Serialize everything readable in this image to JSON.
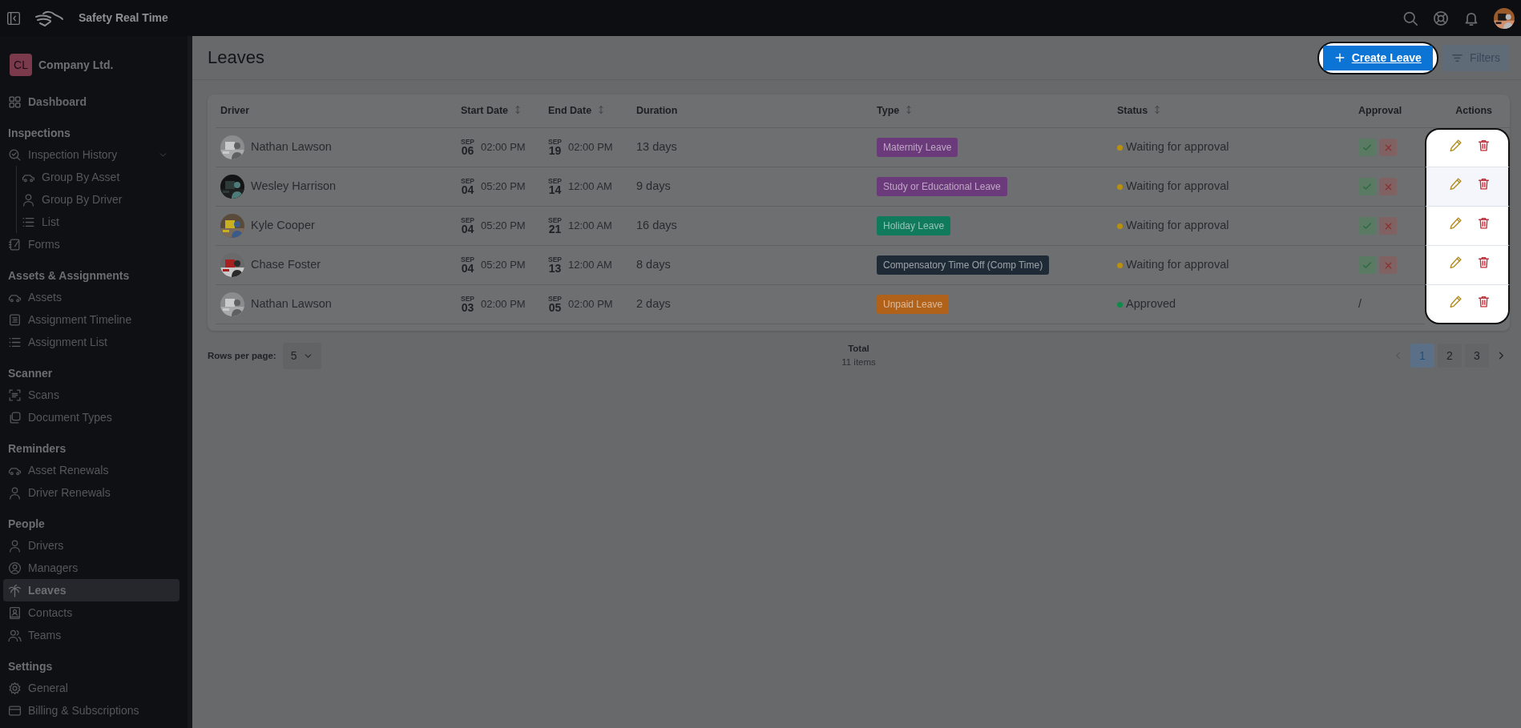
{
  "topbar": {
    "app_name": "Safety Real Time"
  },
  "sidebar": {
    "company": {
      "initials": "CL",
      "name": "Company Ltd."
    },
    "sections": [
      {
        "items": [
          {
            "label": "Dashboard",
            "selected": false
          }
        ]
      },
      {
        "title": "Inspections",
        "items": [
          {
            "label": "Inspection History",
            "selected": false,
            "expanded": true,
            "children": [
              {
                "label": "Group By Asset",
                "selected": false
              },
              {
                "label": "Group By Driver",
                "selected": false
              },
              {
                "label": "List",
                "selected": false
              }
            ]
          },
          {
            "label": "Forms",
            "selected": false
          }
        ]
      },
      {
        "title": "Assets & Assignments",
        "items": [
          {
            "label": "Assets",
            "selected": false
          },
          {
            "label": "Assignment Timeline",
            "selected": false
          },
          {
            "label": "Assignment List",
            "selected": false
          }
        ]
      },
      {
        "title": "Scanner",
        "items": [
          {
            "label": "Scans",
            "selected": false
          },
          {
            "label": "Document Types",
            "selected": false
          }
        ]
      },
      {
        "title": "Reminders",
        "items": [
          {
            "label": "Asset Renewals",
            "selected": false
          },
          {
            "label": "Driver Renewals",
            "selected": false
          }
        ]
      },
      {
        "title": "People",
        "items": [
          {
            "label": "Drivers",
            "selected": false
          },
          {
            "label": "Managers",
            "selected": false
          },
          {
            "label": "Leaves",
            "selected": true
          },
          {
            "label": "Contacts",
            "selected": false
          },
          {
            "label": "Teams",
            "selected": false
          }
        ]
      },
      {
        "title": "Settings",
        "items": [
          {
            "label": "General",
            "selected": false
          },
          {
            "label": "Billing & Subscriptions",
            "selected": false
          }
        ]
      }
    ]
  },
  "page": {
    "title": "Leaves",
    "create_button": {
      "label": "Create Leave",
      "spotlight": true
    },
    "filters_button": {
      "label": "Filters"
    }
  },
  "table": {
    "actions_spotlight": true,
    "columns": [
      {
        "label": "Driver",
        "sortable": false
      },
      {
        "label": "Start Date",
        "sortable": true
      },
      {
        "label": "End Date",
        "sortable": true
      },
      {
        "label": "Duration",
        "sortable": false
      },
      {
        "label": "Type",
        "sortable": true
      },
      {
        "label": "Status",
        "sortable": true
      },
      {
        "label": "Approval",
        "sortable": false
      },
      {
        "label": "Actions",
        "sortable": false
      }
    ],
    "rows": [
      {
        "driver": "Nathan Lawson",
        "start": {
          "month": "SEP",
          "day": "06",
          "time": "02:00 PM"
        },
        "end": {
          "month": "SEP",
          "day": "19",
          "time": "02:00 PM"
        },
        "duration": "13 days",
        "type": {
          "label": "Maternity Leave",
          "color": "#6b3a7a"
        },
        "status": {
          "label": "Waiting for approval",
          "color": "#b8900e"
        },
        "approval": {
          "kind": "buttons"
        }
      },
      {
        "driver": "Wesley Harrison",
        "start": {
          "month": "SEP",
          "day": "04",
          "time": "05:20 PM"
        },
        "end": {
          "month": "SEP",
          "day": "14",
          "time": "12:00 AM"
        },
        "duration": "9 days",
        "type": {
          "label": "Study or Educational Leave",
          "color": "#6b3a7a"
        },
        "status": {
          "label": "Waiting for approval",
          "color": "#b8900e"
        },
        "approval": {
          "kind": "buttons"
        }
      },
      {
        "driver": "Kyle Cooper",
        "start": {
          "month": "SEP",
          "day": "04",
          "time": "05:20 PM"
        },
        "end": {
          "month": "SEP",
          "day": "21",
          "time": "12:00 AM"
        },
        "duration": "16 days",
        "type": {
          "label": "Holiday Leave",
          "color": "#107a5c"
        },
        "status": {
          "label": "Waiting for approval",
          "color": "#b8900e"
        },
        "approval": {
          "kind": "buttons"
        }
      },
      {
        "driver": "Chase Foster",
        "start": {
          "month": "SEP",
          "day": "04",
          "time": "05:20 PM"
        },
        "end": {
          "month": "SEP",
          "day": "13",
          "time": "12:00 AM"
        },
        "duration": "8 days",
        "type": {
          "label": "Compensatory Time Off (Comp Time)",
          "color": "#1f2a37"
        },
        "status": {
          "label": "Waiting for approval",
          "color": "#b8900e"
        },
        "approval": {
          "kind": "buttons"
        }
      },
      {
        "driver": "Nathan Lawson",
        "start": {
          "month": "SEP",
          "day": "03",
          "time": "02:00 PM"
        },
        "end": {
          "month": "SEP",
          "day": "05",
          "time": "02:00 PM"
        },
        "duration": "2 days",
        "type": {
          "label": "Unpaid Leave",
          "color": "#b0621a"
        },
        "status": {
          "label": "Approved",
          "color": "#0e8a4a"
        },
        "approval": {
          "kind": "text",
          "text": "/"
        }
      }
    ]
  },
  "footer": {
    "rows_label": "Rows per page:",
    "rows_value": "5",
    "total_label": "Total",
    "total_count": "11 items",
    "pages": [
      {
        "label": "1",
        "selected": true
      },
      {
        "label": "2",
        "selected": false
      },
      {
        "label": "3",
        "selected": false
      }
    ]
  }
}
